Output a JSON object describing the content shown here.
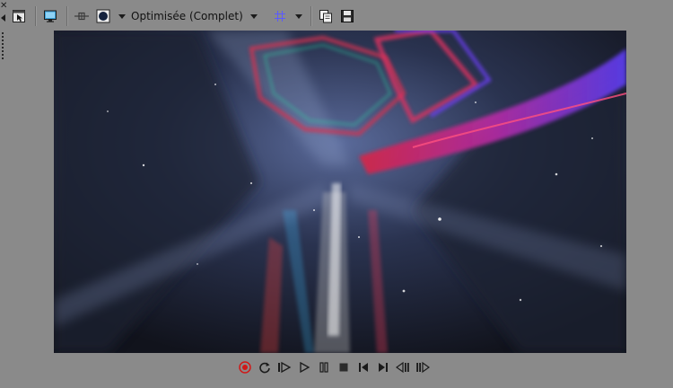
{
  "toolbar": {
    "quality_label": "Optimisée (Complet)",
    "icons": [
      "cursor-window-icon",
      "monitor-icon",
      "split-view-icon",
      "circle-overlay-icon",
      "grid-icon",
      "copy-snapshot-icon",
      "save-snapshot-icon"
    ]
  },
  "transport": {
    "icons": [
      "record-icon",
      "loop-icon",
      "play-from-start-icon",
      "play-icon",
      "pause-icon",
      "stop-icon",
      "previous-frame-icon",
      "next-frame-icon",
      "step-back-icon",
      "step-forward-icon"
    ]
  },
  "colors": {
    "panel_bg": "#8a8a8a",
    "record_accent": "#d01818",
    "grid_accent": "#5a5aff",
    "monitor_accent": "#3aa0d8"
  }
}
